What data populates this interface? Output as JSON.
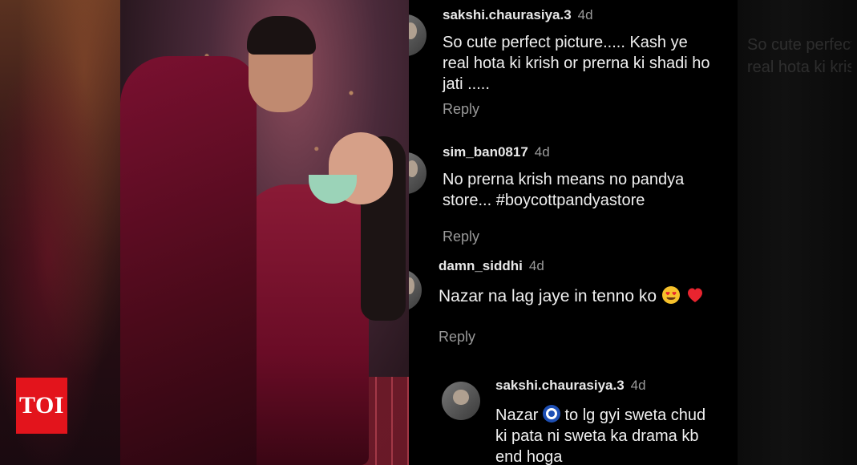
{
  "watermark": {
    "label": "TOI",
    "color": "#e3141c"
  },
  "comments": [
    {
      "username": "sakshi.chaurasiya.3",
      "time": "4d",
      "text_lines": [
        "So cute perfect picture..... Kash ye",
        "real hota ki krish or prerna ki shadi ho",
        "jati ....."
      ],
      "reply_label": "Reply"
    },
    {
      "username": "sim_ban0817",
      "time": "4d",
      "text_lines": [
        "No prerna krish means no pandya",
        "store... #boycottpandyastore"
      ],
      "reply_label": "Reply"
    },
    {
      "username": "damn_siddhi",
      "time": "4d",
      "text_lines": [
        "Nazar na lag jaye in tenno ko"
      ],
      "emojis": [
        "heart-eyes-emoji",
        "red-heart-emoji"
      ],
      "reply_label": "Reply"
    },
    {
      "username": "sakshi.chaurasiya.3",
      "time": "4d",
      "text_lines": [
        "Nazar",
        "to lg gyi sweta chud",
        "ki  pata ni sweta ka drama kb",
        "end hoga"
      ],
      "emojis": [
        "nazar-amulet-emoji"
      ]
    }
  ],
  "background_ghost": {
    "line1": "So cute perfect",
    "line2": "real hota ki krish"
  }
}
